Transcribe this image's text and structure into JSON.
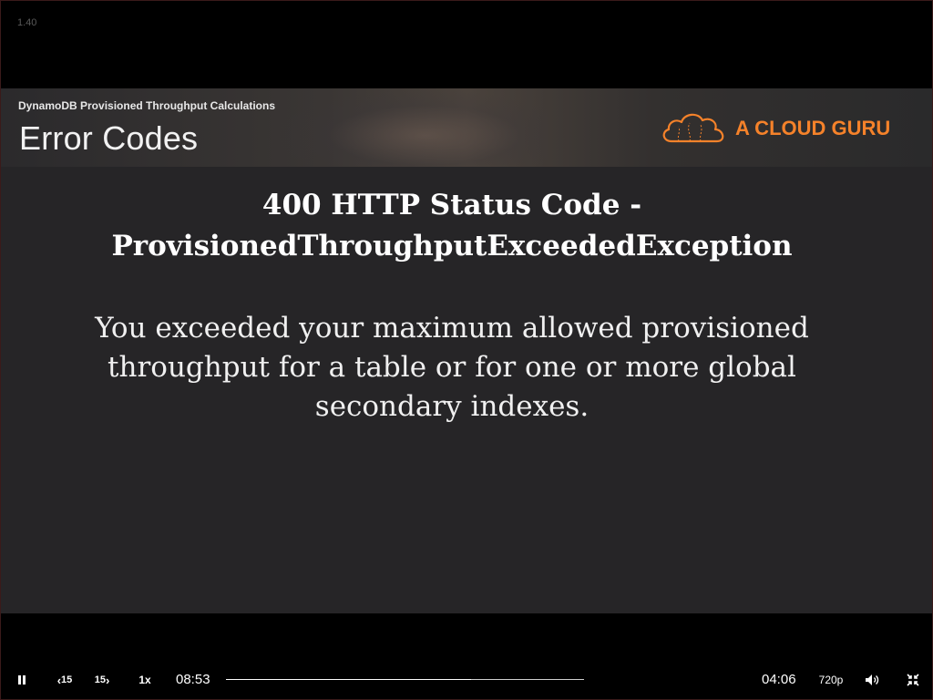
{
  "player": {
    "version_label": "1.40"
  },
  "slide": {
    "course_title": "DynamoDB Provisioned Throughput Calculations",
    "title": "Error Codes",
    "brand_name": "A CLOUD GURU",
    "brand_color": "#f5822a",
    "error_heading_line1": "400 HTTP Status Code -",
    "error_heading_line2": "ProvisionedThroughputExceededException",
    "description_line1": "You exceeded your maximum allowed provisioned",
    "description_line2": "throughput for a table or for one or more global",
    "description_line3": "secondary indexes."
  },
  "controls": {
    "pause_icon": "pause-icon",
    "rewind_label": "15",
    "forward_label": "15",
    "speed_label": "1x",
    "elapsed_time": "08:53",
    "remaining_time": "04:06",
    "quality_label": "720p",
    "volume_icon": "volume-icon",
    "fullscreen_icon": "exit-fullscreen-icon"
  }
}
